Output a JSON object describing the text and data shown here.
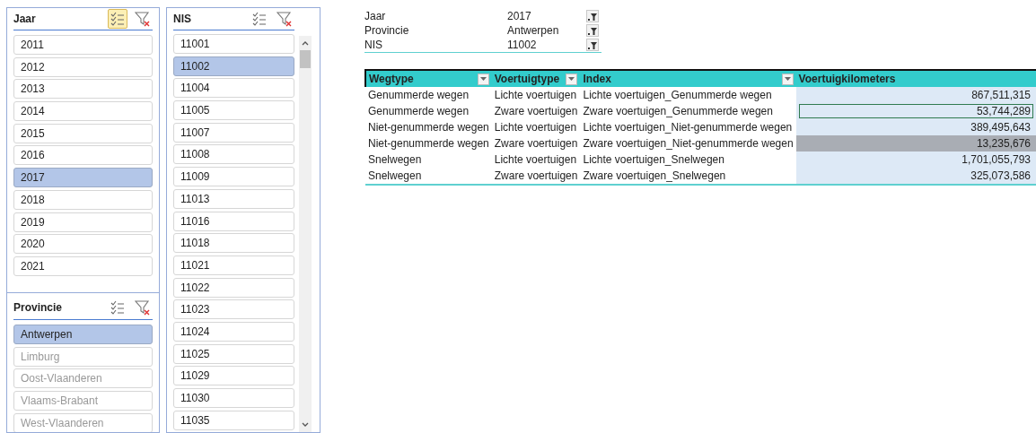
{
  "slicers_left": [
    {
      "title": "Jaar",
      "multiselect": true,
      "items": [
        {
          "label": "2011",
          "selected": false,
          "disabled": false
        },
        {
          "label": "2012",
          "selected": false,
          "disabled": false
        },
        {
          "label": "2013",
          "selected": false,
          "disabled": false
        },
        {
          "label": "2014",
          "selected": false,
          "disabled": false
        },
        {
          "label": "2015",
          "selected": false,
          "disabled": false
        },
        {
          "label": "2016",
          "selected": false,
          "disabled": false
        },
        {
          "label": "2017",
          "selected": true,
          "disabled": false
        },
        {
          "label": "2018",
          "selected": false,
          "disabled": false
        },
        {
          "label": "2019",
          "selected": false,
          "disabled": false
        },
        {
          "label": "2020",
          "selected": false,
          "disabled": false
        },
        {
          "label": "2021",
          "selected": false,
          "disabled": false
        }
      ]
    },
    {
      "title": "Provincie",
      "multiselect": false,
      "items": [
        {
          "label": "Antwerpen",
          "selected": true,
          "disabled": false
        },
        {
          "label": "Limburg",
          "selected": false,
          "disabled": true
        },
        {
          "label": "Oost-Vlaanderen",
          "selected": false,
          "disabled": true
        },
        {
          "label": "Vlaams-Brabant",
          "selected": false,
          "disabled": true
        },
        {
          "label": "West-Vlaanderen",
          "selected": false,
          "disabled": true
        }
      ]
    }
  ],
  "slicer_nis": {
    "title": "NIS",
    "multiselect": false,
    "items": [
      {
        "label": "11001",
        "selected": false,
        "disabled": false
      },
      {
        "label": "11002",
        "selected": true,
        "disabled": false
      },
      {
        "label": "11004",
        "selected": false,
        "disabled": false
      },
      {
        "label": "11005",
        "selected": false,
        "disabled": false
      },
      {
        "label": "11007",
        "selected": false,
        "disabled": false
      },
      {
        "label": "11008",
        "selected": false,
        "disabled": false
      },
      {
        "label": "11009",
        "selected": false,
        "disabled": false
      },
      {
        "label": "11013",
        "selected": false,
        "disabled": false
      },
      {
        "label": "11016",
        "selected": false,
        "disabled": false
      },
      {
        "label": "11018",
        "selected": false,
        "disabled": false
      },
      {
        "label": "11021",
        "selected": false,
        "disabled": false
      },
      {
        "label": "11022",
        "selected": false,
        "disabled": false
      },
      {
        "label": "11023",
        "selected": false,
        "disabled": false
      },
      {
        "label": "11024",
        "selected": false,
        "disabled": false
      },
      {
        "label": "11025",
        "selected": false,
        "disabled": false
      },
      {
        "label": "11029",
        "selected": false,
        "disabled": false
      },
      {
        "label": "11030",
        "selected": false,
        "disabled": false
      },
      {
        "label": "11035",
        "selected": false,
        "disabled": false
      }
    ]
  },
  "pivot_filters": [
    {
      "label": "Jaar",
      "value": "2017"
    },
    {
      "label": "Provincie",
      "value": "Antwerpen"
    },
    {
      "label": "NIS",
      "value": "11002"
    }
  ],
  "pivot_table": {
    "columns": [
      {
        "label": "Wegtype",
        "dropdown": true
      },
      {
        "label": "Voertuigtype",
        "dropdown": true
      },
      {
        "label": "Index",
        "dropdown": true
      },
      {
        "label": "Voertuigkilometers",
        "dropdown": false
      }
    ],
    "rows": [
      {
        "cells": [
          "Genummerde wegen",
          "Lichte voertuigen",
          "Lichte voertuigen_Genummerde wegen",
          "867,511,315"
        ],
        "selected": false,
        "highlighted": false
      },
      {
        "cells": [
          "Genummerde wegen",
          "Zware voertuigen",
          "Zware voertuigen_Genummerde wegen",
          "53,744,289"
        ],
        "selected": true,
        "highlighted": false
      },
      {
        "cells": [
          "Niet-genummerde wegen",
          "Lichte voertuigen",
          "Lichte voertuigen_Niet-genummerde wegen",
          "389,495,643"
        ],
        "selected": false,
        "highlighted": false
      },
      {
        "cells": [
          "Niet-genummerde wegen",
          "Zware voertuigen",
          "Zware voertuigen_Niet-genummerde wegen",
          "13,235,676"
        ],
        "selected": false,
        "highlighted": true
      },
      {
        "cells": [
          "Snelwegen",
          "Lichte voertuigen",
          "Lichte voertuigen_Snelwegen",
          "1,701,055,793"
        ],
        "selected": false,
        "highlighted": false
      },
      {
        "cells": [
          "Snelwegen",
          "Zware voertuigen",
          "Zware voertuigen_Snelwegen",
          "325,073,586"
        ],
        "selected": false,
        "highlighted": false
      }
    ]
  }
}
